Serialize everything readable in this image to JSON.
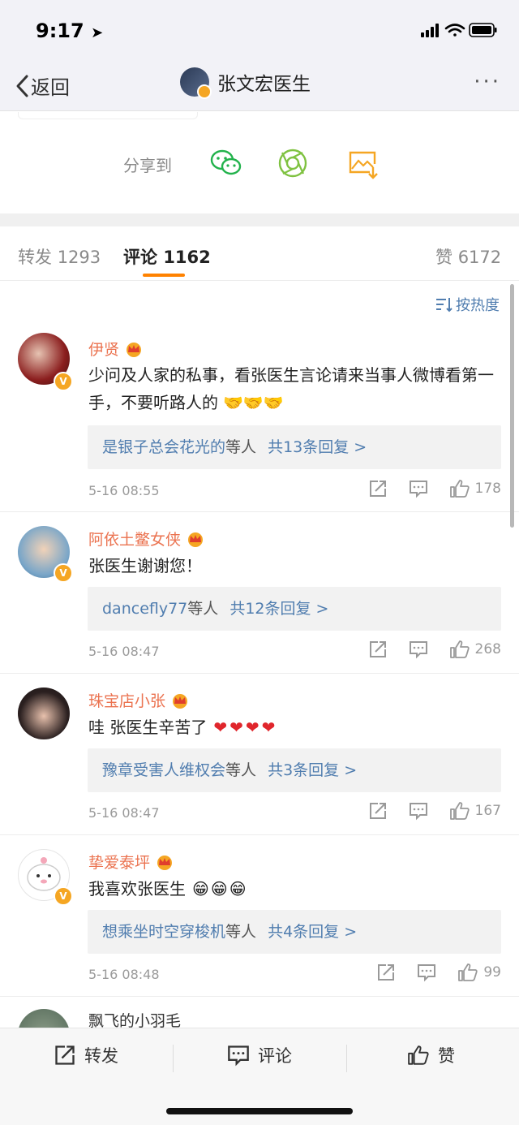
{
  "status": {
    "time": "9:17"
  },
  "nav": {
    "back_label": "返回",
    "title": "张文宏医生",
    "more": "···"
  },
  "share": {
    "label": "分享到",
    "targets": [
      "wechat-icon",
      "moments-icon",
      "save-image-icon"
    ]
  },
  "tabs": [
    {
      "label": "转发",
      "count": "1293"
    },
    {
      "label": "评论",
      "count": "1162"
    },
    {
      "label": "赞",
      "count": "6172"
    }
  ],
  "sort_label": "按热度",
  "comments": [
    {
      "name": "伊贤",
      "text": "少问及人家的私事，看张医生言论请来当事人微博看第一手，不要听路人的",
      "emoji": "🤝🤝🤝",
      "reply_user": "是银子总会花光的",
      "reply_mid": "等人",
      "reply_count": "共13条回复 >",
      "time": "5-16 08:55",
      "likes": "178"
    },
    {
      "name": "阿依土鳖女侠",
      "text": "张医生谢谢您！",
      "emoji": "",
      "reply_user": "dancefly77",
      "reply_mid": "等人",
      "reply_count": "共12条回复 >",
      "time": "5-16 08:47",
      "likes": "268"
    },
    {
      "name": "珠宝店小张",
      "text": "哇 张医生辛苦了",
      "emoji": "❤❤❤❤",
      "reply_user": "豫章受害人维权会",
      "reply_mid": "等人",
      "reply_count": "共3条回复 >",
      "time": "5-16 08:47",
      "likes": "167"
    },
    {
      "name": "挚爱泰坪",
      "text": "我喜欢张医生",
      "emoji": "😁😁😁",
      "reply_user": "想乘坐时空穿梭机",
      "reply_mid": "等人",
      "reply_count": "共4条回复 >",
      "time": "5-16 08:48",
      "likes": "99"
    },
    {
      "name": "飘飞的小羽毛"
    }
  ],
  "bottom": {
    "repost": "转发",
    "comment": "评论",
    "like": "赞"
  },
  "colors": {
    "username": "#eb7350",
    "link": "#507daf",
    "accent": "#ff8200",
    "badge": "#f5a623"
  }
}
